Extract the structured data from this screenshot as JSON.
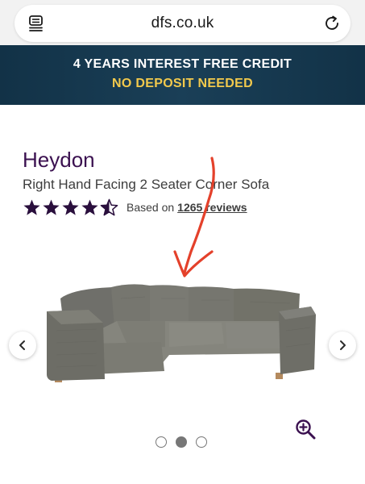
{
  "browser": {
    "url": "dfs.co.uk",
    "tabs_icon": "tabs-icon",
    "reload_icon": "reload-icon"
  },
  "promo": {
    "line1": "4 YEARS INTEREST FREE CREDIT",
    "line2": "NO DEPOSIT NEEDED",
    "line2_color": "#f2c94c",
    "background": "#143549"
  },
  "product": {
    "title": "Heydon",
    "subtitle": "Right Hand Facing 2 Seater Corner Sofa",
    "rating": 4.5,
    "rating_max": 5,
    "reviews_prefix": "Based on",
    "reviews_link": "1265 reviews",
    "brand_color": "#3b1150"
  },
  "carousel": {
    "prev_icon": "chevron-left-icon",
    "next_icon": "chevron-right-icon",
    "zoom_icon": "zoom-in-icon",
    "slides": 3,
    "active_slide": 2
  }
}
